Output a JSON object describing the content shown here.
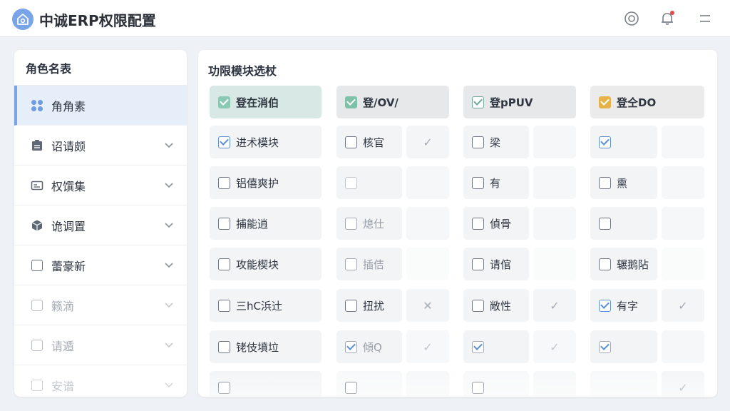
{
  "app": {
    "title": "中诚ERP权限配置"
  },
  "header_icons": {
    "settings": "settings-icon",
    "bell": "bell-icon",
    "menu": "menu-icon"
  },
  "colors": {
    "accent": "#7aa4e8",
    "check": "#5b8fd6",
    "green": "#7fc1a8",
    "amber": "#e6b24a",
    "alert": "#e04a4a"
  },
  "sidebar": {
    "title": "角色名表",
    "items": [
      {
        "label": "角角素",
        "icon": "grid-icon",
        "active": true
      },
      {
        "label": "诏请颇",
        "icon": "clipboard-icon"
      },
      {
        "label": "权馔集",
        "icon": "card-icon"
      },
      {
        "label": "诡调置",
        "icon": "cube-icon"
      },
      {
        "label": "蕾豪新",
        "icon": "checkbox-icon"
      },
      {
        "label": "籁滴",
        "icon": "checkbox-icon"
      },
      {
        "label": "请遁",
        "icon": "checkbox-icon"
      },
      {
        "label": "安谱",
        "icon": "checkbox-icon"
      }
    ]
  },
  "main": {
    "title": "功限模块选杖",
    "columns": [
      {
        "header": "登在消伯"
      },
      {
        "header": "登/OV/"
      },
      {
        "header": "登pPUV"
      },
      {
        "header": "登仝DO"
      }
    ],
    "rows": [
      [
        "进术模块",
        "核官",
        "梁",
        ""
      ],
      [
        "铝僖爽护",
        "",
        "有",
        "熏"
      ],
      [
        "捕能逍",
        "熄仕",
        "偵骨",
        ""
      ],
      [
        "攻能楔块",
        "插佶",
        "请倌",
        "辗鹅阽"
      ],
      [
        "三hC浜辻",
        "扭扰",
        "敞性",
        "有字"
      ],
      [
        "铑伎墳垃",
        "傾Q",
        "",
        ""
      ],
      [
        "",
        "",
        "",
        ""
      ]
    ]
  }
}
